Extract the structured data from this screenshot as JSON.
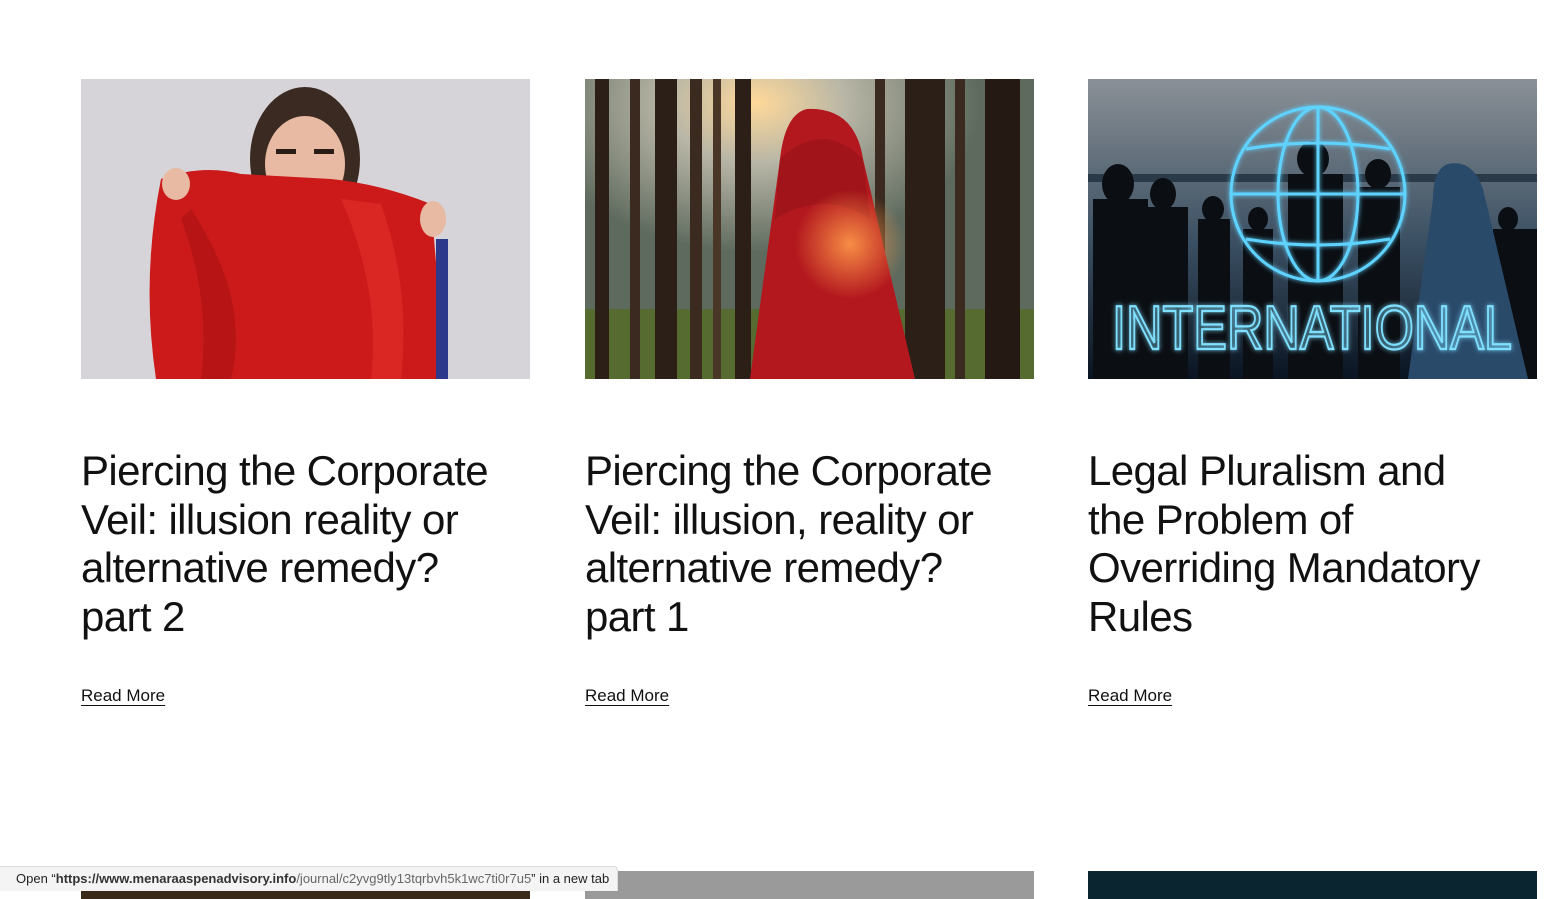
{
  "articles": [
    {
      "title": "Piercing the Corporate Veil: illusion reality or alternative remedy? part 2",
      "read_more": "Read More",
      "image": "woman-red-cloth"
    },
    {
      "title": "Piercing the Corporate Veil: illusion, reality or alternative remedy? part 1",
      "read_more": "Read More",
      "image": "red-cloak-forest"
    },
    {
      "title": "Legal Pluralism and the Problem of Overriding Mandatory Rules",
      "read_more": "Read More",
      "image": "international-globe",
      "image_text": "INTERNATIONAL"
    }
  ],
  "status_bar": {
    "prefix": "Open “",
    "host": "https://www.menaraaspenadvisory.info",
    "path": "/journal/c2yvg9tly13tqrbvh5k1wc7ti0r7u5",
    "suffix": "” in a new tab"
  },
  "colors": {
    "text": "#111111",
    "background": "#ffffff",
    "neon": "#5fd3ff"
  }
}
